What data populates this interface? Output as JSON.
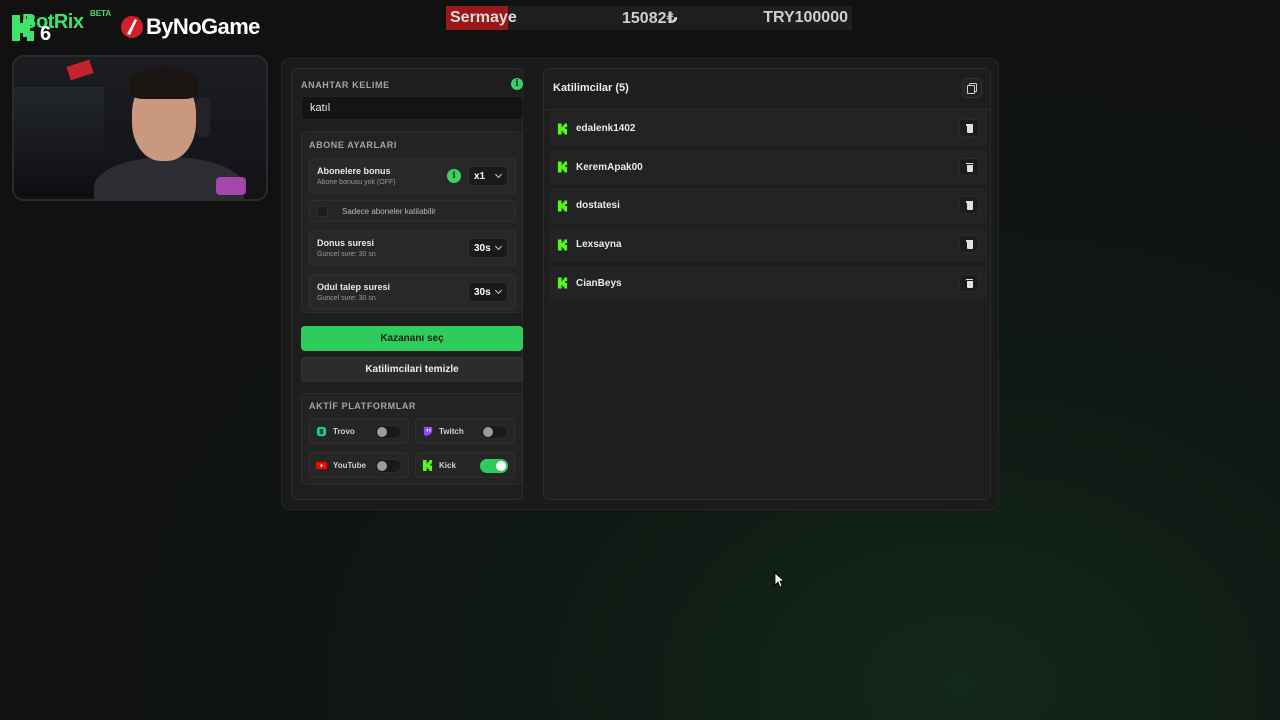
{
  "brand": {
    "botrix_text": "BotRix",
    "botrix_number": "6",
    "beta": "BETA",
    "partner": "ByNoGame"
  },
  "capital": {
    "label": "Sermaye",
    "amount": "15082₺",
    "target": "TRY100000",
    "progress_fraction": 0.15
  },
  "keyword": {
    "title": "ANAHTAR KELIME",
    "value": "katıl"
  },
  "subscriber_settings": {
    "title": "ABONE AYARLARI",
    "bonus": {
      "title": "Abonelere bonus",
      "subtitle": "Abone bonusu yok (OFF)",
      "selected": "x1"
    },
    "subscribers_only": {
      "label": "Sadece aboneler katilabilir",
      "checked": false
    },
    "bonus_duration": {
      "title": "Donus suresi",
      "subtitle": "Guncel sure: 30 sn",
      "selected": "30s"
    },
    "claim_duration": {
      "title": "Odul talep suresi",
      "subtitle": "Guncel sure: 30 sn",
      "selected": "30s"
    }
  },
  "actions": {
    "pick_winner": "Kazananı seç",
    "clear_participants": "Katilimcilari temizle"
  },
  "platforms": {
    "title": "AKTİF PLATFORMLAR",
    "items": [
      {
        "name": "Trovo",
        "icon": "trovo-icon",
        "enabled": false,
        "color": "#1fd67e"
      },
      {
        "name": "Twitch",
        "icon": "twitch-icon",
        "enabled": false,
        "color": "#9146ff"
      },
      {
        "name": "YouTube",
        "icon": "youtube-icon",
        "enabled": false,
        "color": "#ff0000"
      },
      {
        "name": "Kick",
        "icon": "kick-icon",
        "enabled": true,
        "color": "#53fc18"
      }
    ]
  },
  "participants": {
    "title": "Katilimcilar (5)",
    "list": [
      {
        "name": "edalenk1402",
        "platform": "kick-icon"
      },
      {
        "name": "KeremApak00",
        "platform": "kick-icon"
      },
      {
        "name": "dostatesi",
        "platform": "kick-icon"
      },
      {
        "name": "Lexsayna",
        "platform": "kick-icon"
      },
      {
        "name": "CianBeys",
        "platform": "kick-icon"
      }
    ]
  },
  "colors": {
    "accent": "#2ecc5b",
    "kick": "#53fc18",
    "capital_bar": "#9b1818"
  }
}
